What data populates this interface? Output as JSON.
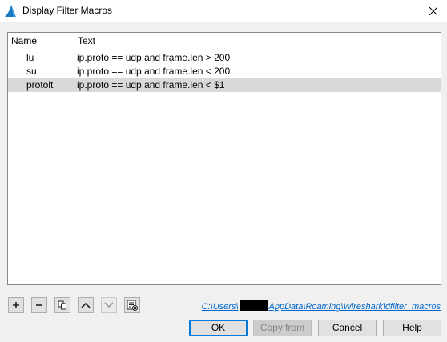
{
  "window": {
    "title": "Display Filter Macros",
    "icon": "wireshark-fin-icon",
    "accent_color": "#1679c5"
  },
  "table": {
    "columns": [
      "Name",
      "Text"
    ],
    "rows": [
      {
        "name": "lu",
        "text": "ip.proto == udp and frame.len > 200",
        "selected": false
      },
      {
        "name": "su",
        "text": "ip.proto == udp and frame.len < 200",
        "selected": false
      },
      {
        "name": "protolt",
        "text": "ip.proto == udp and frame.len < $1",
        "selected": true
      }
    ]
  },
  "toolbar": {
    "buttons": [
      {
        "icon": "plus-icon",
        "enabled": true
      },
      {
        "icon": "minus-icon",
        "enabled": true
      },
      {
        "icon": "copy-icon",
        "enabled": true
      },
      {
        "icon": "arrow-up-icon",
        "enabled": true
      },
      {
        "icon": "arrow-down-icon",
        "enabled": false
      },
      {
        "icon": "clear-list-icon",
        "enabled": true
      }
    ]
  },
  "file_path": {
    "prefix": "C:\\Users\\",
    "suffix": "AppData\\Roaming\\Wireshark\\dfilter_macros"
  },
  "buttons": {
    "ok": "OK",
    "copy_from": "Copy from",
    "cancel": "Cancel",
    "help": "Help"
  }
}
